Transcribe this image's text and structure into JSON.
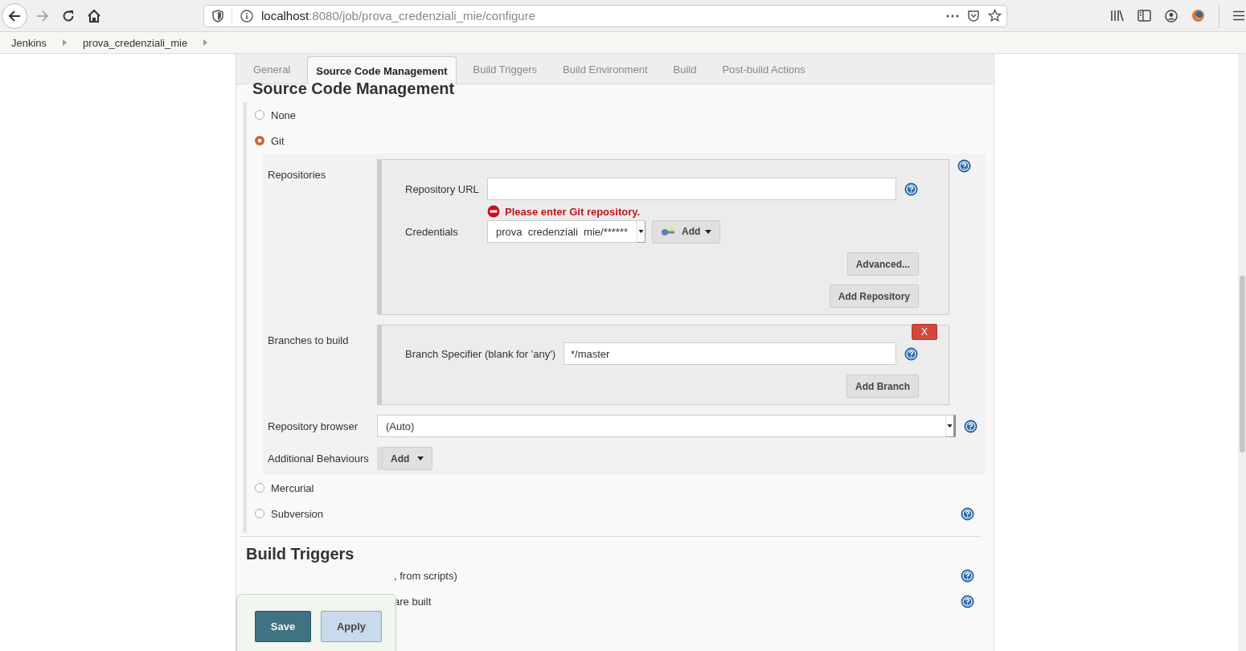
{
  "browser": {
    "url_host": "localhost",
    "url_rest": ":8080/job/prova_credenziali_mie/configure"
  },
  "breadcrumbs": [
    "Jenkins",
    "prova_credenziali_mie"
  ],
  "tabs": [
    {
      "label": "General",
      "selected": false
    },
    {
      "label": "Source Code Management",
      "selected": true
    },
    {
      "label": "Build Triggers",
      "selected": false
    },
    {
      "label": "Build Environment",
      "selected": false
    },
    {
      "label": "Build",
      "selected": false
    },
    {
      "label": "Post-build Actions",
      "selected": false
    }
  ],
  "scm": {
    "title": "Source Code Management",
    "options": [
      {
        "label": "None",
        "selected": false
      },
      {
        "label": "Git",
        "selected": true
      },
      {
        "label": "Mercurial",
        "selected": false
      },
      {
        "label": "Subversion",
        "selected": false
      }
    ]
  },
  "git": {
    "repositories_label": "Repositories",
    "repository_url_label": "Repository URL",
    "error": "Please enter Git repository.",
    "credentials_label": "Credentials",
    "credentials_value": "prova  credenziali  mie/******",
    "add_credentials": "Add",
    "advanced": "Advanced...",
    "add_repository": "Add Repository",
    "branches_label": "Branches to build",
    "remove": "X",
    "branch_specifier_label": "Branch Specifier (blank for 'any')",
    "branch_specifier_value": "*/master",
    "add_branch": "Add Branch",
    "repository_browser_label": "Repository browser",
    "repository_browser_value": "(Auto)",
    "additional_behaviours_label": "Additional Behaviours",
    "additional_add": "Add"
  },
  "build_triggers": {
    "title": "Build Triggers",
    "items": [
      ", from scripts)",
      "are built"
    ]
  },
  "actions": [
    {
      "label": "Save",
      "kind": "primary"
    },
    {
      "label": "Apply",
      "kind": "secondary"
    }
  ]
}
